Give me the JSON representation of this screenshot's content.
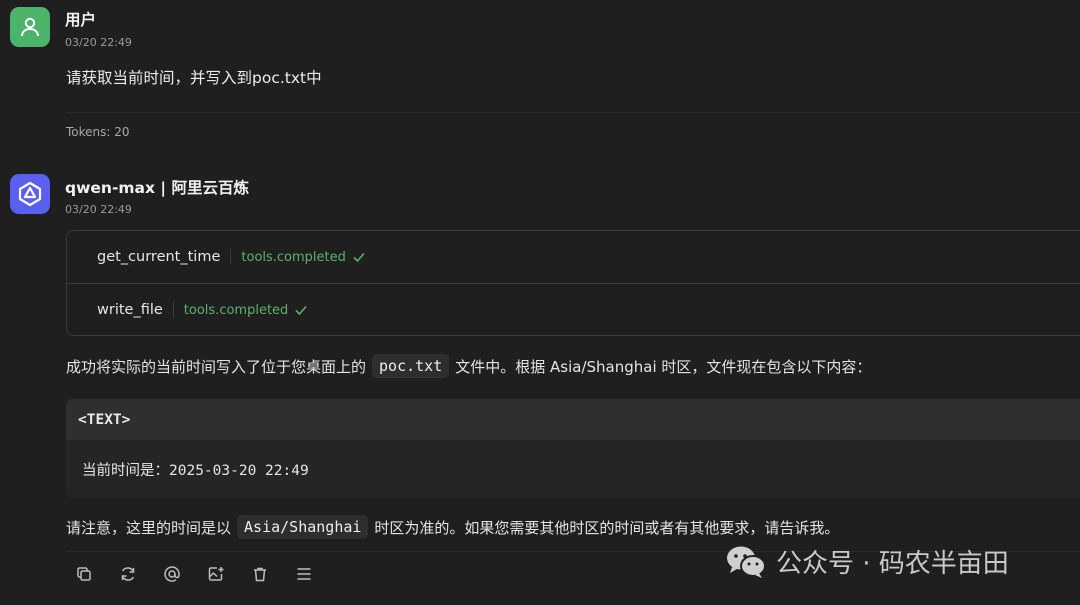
{
  "user_message": {
    "author": "用户",
    "time": "03/20 22:49",
    "text": "请获取当前时间，并写入到poc.txt中",
    "tokens": "Tokens: 20"
  },
  "assistant_message": {
    "author": "qwen-max | 阿里云百炼",
    "time": "03/20 22:49",
    "tools": [
      {
        "name": "get_current_time",
        "status": "tools.completed"
      },
      {
        "name": "write_file",
        "status": "tools.completed"
      }
    ],
    "para1_before": "成功将实际的当前时间写入了位于您桌面上的",
    "para1_code": "poc.txt",
    "para1_after": "文件中。根据 Asia/Shanghai 时区，文件现在包含以下内容：",
    "code_block": {
      "lang": "<TEXT>",
      "content": "当前时间是：2025-03-20 22:49"
    },
    "para2_before": "请注意，这里的时间是以",
    "para2_code": "Asia/Shanghai",
    "para2_after": "时区为准的。如果您需要其他时区的时间或者有其他要求，请告诉我。"
  },
  "actions": [
    "copy-icon",
    "refresh-icon",
    "mention-icon",
    "add-image-icon",
    "trash-icon",
    "menu-icon"
  ],
  "watermark": "公众号 · 码农半亩田",
  "colors": {
    "user_avatar": "#4cb36a",
    "bot_avatar": "#5b5ff0",
    "success": "#59b36a",
    "background": "#1f1f20"
  }
}
